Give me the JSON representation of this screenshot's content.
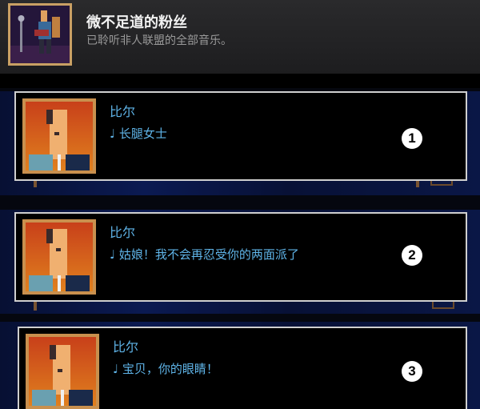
{
  "achievement": {
    "title": "微不足道的粉丝",
    "description": "已聆听非人联盟的全部音乐。"
  },
  "dialogs": [
    {
      "speaker": "比尔",
      "line": "♩ 长腿女士",
      "number": "1"
    },
    {
      "speaker": "比尔",
      "line": "♩ 姑娘！我不会再忍受你的两面派了",
      "number": "2"
    },
    {
      "speaker": "比尔",
      "line": "♩ 宝贝，你的眼睛！",
      "number": "3"
    }
  ],
  "colors": {
    "dialog_text": "#5fb4e8",
    "portrait_border": "#c9904e",
    "icon_border": "#c9a064"
  }
}
